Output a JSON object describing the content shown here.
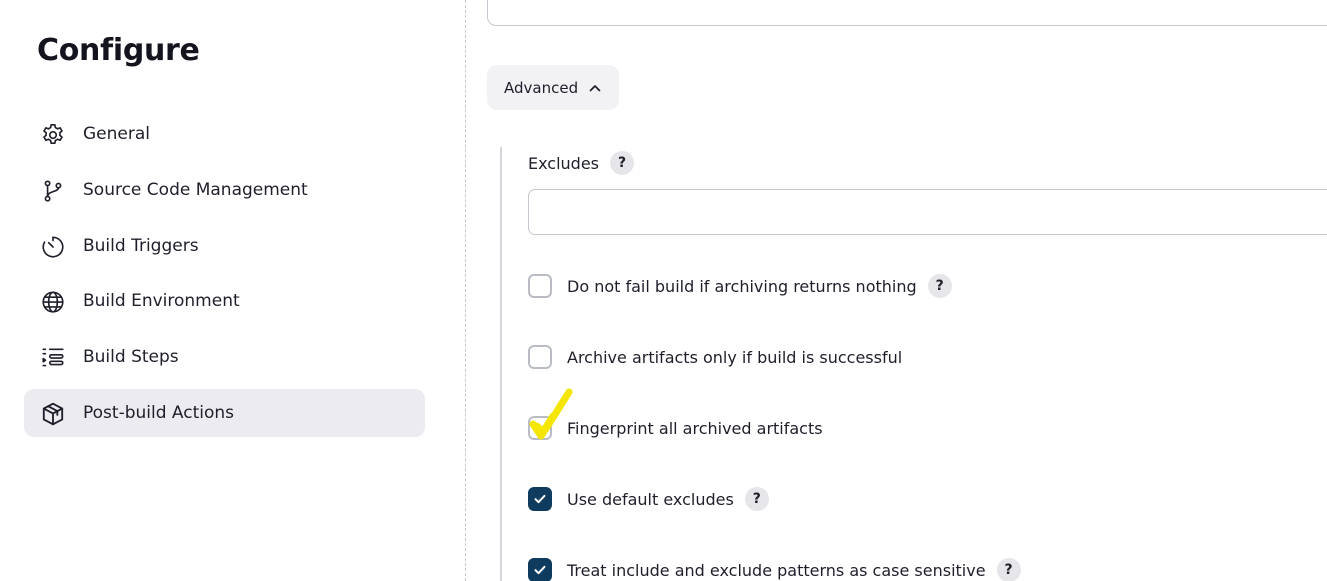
{
  "sidebar": {
    "title": "Configure",
    "items": [
      {
        "label": "General",
        "icon": "gear-icon",
        "active": false
      },
      {
        "label": "Source Code Management",
        "icon": "git-branch-icon",
        "active": false
      },
      {
        "label": "Build Triggers",
        "icon": "timer-icon",
        "active": false
      },
      {
        "label": "Build Environment",
        "icon": "globe-icon",
        "active": false
      },
      {
        "label": "Build Steps",
        "icon": "list-steps-icon",
        "active": false
      },
      {
        "label": "Post-build Actions",
        "icon": "package-icon",
        "active": true
      }
    ]
  },
  "main": {
    "advanced_label": "Advanced",
    "advanced_icon": "chevron-up-icon",
    "excludes": {
      "label": "Excludes",
      "help": "?",
      "value": "",
      "placeholder": ""
    },
    "options": [
      {
        "label": "Do not fail build if archiving returns nothing",
        "checked": false,
        "help": "?"
      },
      {
        "label": "Archive artifacts only if build is successful",
        "checked": false,
        "help": ""
      },
      {
        "label": "Fingerprint all archived artifacts",
        "checked": false,
        "help": ""
      },
      {
        "label": "Use default excludes",
        "checked": true,
        "help": "?"
      },
      {
        "label": "Treat include and exclude patterns as case sensitive",
        "checked": true,
        "help": "?"
      }
    ]
  },
  "annotation": {
    "mark": "yellow-checkmark",
    "color": "#f5e600"
  },
  "colors": {
    "accent": "#0f3b5f",
    "active_nav_bg": "#ebebf0",
    "help_bg": "#e6e6ea"
  }
}
